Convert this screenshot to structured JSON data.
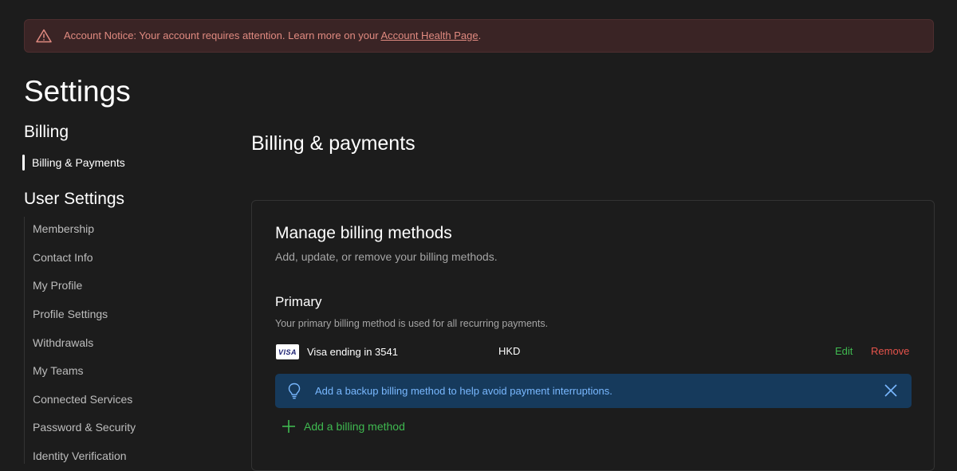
{
  "notice": {
    "text": "Account Notice: Your account requires attention. Learn more on your ",
    "link": "Account Health Page",
    "suffix": "."
  },
  "page_title": "Settings",
  "sidebar": {
    "billing_heading": "Billing",
    "billing_item": "Billing & Payments",
    "user_heading": "User Settings",
    "items": [
      {
        "label": "Membership"
      },
      {
        "label": "Contact Info"
      },
      {
        "label": "My Profile"
      },
      {
        "label": "Profile Settings"
      },
      {
        "label": "Withdrawals"
      },
      {
        "label": "My Teams"
      },
      {
        "label": "Connected Services"
      },
      {
        "label": "Password & Security"
      },
      {
        "label": "Identity Verification"
      }
    ]
  },
  "main": {
    "heading": "Billing & payments",
    "card": {
      "title": "Manage billing methods",
      "subtitle": "Add, update, or remove your billing methods.",
      "primary_heading": "Primary",
      "primary_desc": "Your primary billing method is used for all recurring payments.",
      "method": {
        "logo_text": "VISA",
        "label": "Visa ending in 3541",
        "currency": "HKD",
        "edit": "Edit",
        "remove": "Remove"
      },
      "tip": "Add a backup billing method to help avoid payment interruptions.",
      "add_label": "Add a billing method"
    }
  },
  "colors": {
    "background": "#1c1c1c",
    "notice_bg": "#3a2425",
    "notice_text": "#e08a80",
    "edit": "#3fb950",
    "remove": "#e5534b",
    "tip_bg": "#163a5c",
    "tip_text": "#79b8ff"
  },
  "icons": [
    "warning-icon",
    "lightbulb-icon",
    "close-icon",
    "plus-icon"
  ]
}
